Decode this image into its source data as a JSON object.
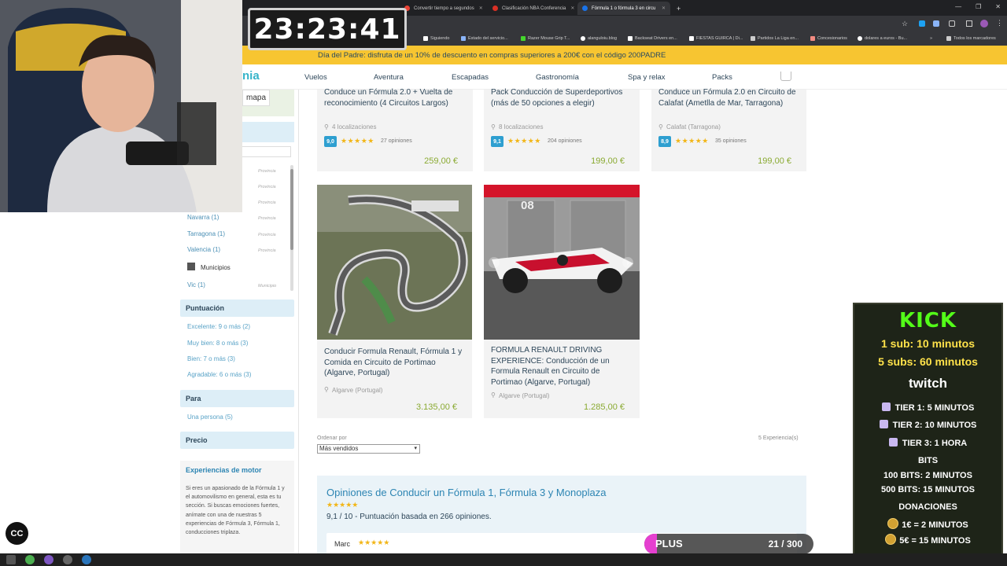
{
  "timer": "23:23:41",
  "browser": {
    "tabs": [
      {
        "label": "Convertir tiempo a segundos",
        "color": "#ea4335"
      },
      {
        "label": "Clasificación NBA Conferencia",
        "color": "#d93025"
      },
      {
        "label": "Fórmula 1 o fórmula 3 en circu",
        "color": "#1a73e8"
      }
    ],
    "new_tab": "+",
    "bookmarks": [
      "Siguiendo",
      "Estado del servicio...",
      "Razer Mouse Grip T...",
      "alanguloiu.blog",
      "Backseat Drivers en...",
      "FIESTAS GUIRCA | Di...",
      "Partidos La Liga en...",
      "Concesionarios",
      "dolares a euros - Bu...",
      "Todos los marcadores"
    ]
  },
  "promo": "Día del Padre: disfruta de un 10% de descuento en compras superiores a 200€ con el código 200PADRE",
  "site": {
    "logo": "nia",
    "nav": [
      "Vuelos",
      "Aventura",
      "Escapadas",
      "Gastronomía",
      "Spa y relax",
      "Packs"
    ]
  },
  "sidebar": {
    "map_label": "mapa",
    "provinces": [
      {
        "name": "Navarra (1)",
        "tag": "Provincia"
      },
      {
        "name": "Tarragona (1)",
        "tag": "Provincia"
      },
      {
        "name": "Valencia (1)",
        "tag": "Provincia"
      }
    ],
    "provincia_tags": [
      "Provincia",
      "Provincia",
      "Provincia"
    ],
    "municipios_label": "Municipios",
    "municipio": {
      "name": "Vic (1)",
      "tag": "Municipio"
    },
    "rating_head": "Puntuación",
    "ratings": [
      "Excelente: 9 o más (2)",
      "Muy bien: 8 o más (3)",
      "Bien: 7 o más (3)",
      "Agradable: 6 o más (3)"
    ],
    "para_head": "Para",
    "para_item": "Una persona (5)",
    "precio_head": "Precio",
    "motor_title": "Experiencias de motor",
    "motor_text": "Si eres un apasionado de la Fórmula 1 y el automovilismo en general, esta es tu sección. Si buscas emociones fuertes, anímate con una de nuestras 5 experiencias de Fórmula 3, Fórmula 1, conducciones triplaza."
  },
  "cards_top": [
    {
      "title": "Conduce un Fórmula 2.0 + Vuelta de reconocimiento (4 Circuitos Largos)",
      "loc": "4 localizaciones",
      "score": "9,0",
      "stars": "★★★★★",
      "opinions": "27 opiniones",
      "price": "259,00 €"
    },
    {
      "title": "Pack Conducción de Superdeportivos (más de 50 opciones a elegir)",
      "loc": "8 localizaciones",
      "score": "9,1",
      "stars": "★★★★★",
      "opinions": "204 opiniones",
      "price": "199,00 €"
    },
    {
      "title": "Conduce un Fórmula 2.0 en Circuito de Calafat (Ametlla de Mar, Tarragona)",
      "loc": "Calafat (Tarragona)",
      "score": "8,9",
      "stars": "★★★★★",
      "opinions": "35 opiniones",
      "price": "199,00 €"
    }
  ],
  "cards_bottom": [
    {
      "title": "Conducir Formula Renault, Fórmula 1 y Comida en Circuito de Portimao (Algarve, Portugal)",
      "loc": "Algarve (Portugal)",
      "price": "3.135,00 €"
    },
    {
      "title": "FORMULA RENAULT DRIVING EXPERIENCE: Conducción de un Formula Renault en Circuito de Portimao (Algarve, Portugal)",
      "loc": "Algarve (Portugal)",
      "price": "1.285,00 €"
    }
  ],
  "car_number": "08",
  "sort": {
    "label": "Ordenar por",
    "value": "Más vendidos"
  },
  "results_count": "5 Experiencia(s)",
  "reviews": {
    "title": "Opiniones de Conducir un Fórmula 1, Fórmula 3 y Monoplaza",
    "stars": "★★★★★",
    "score": "9,1 / 10 - Puntuación basada en 266 opiniones.",
    "first_name": "Marc",
    "first_stars": "★★★★★"
  },
  "panel": {
    "kick": "KICK",
    "kick_1": "1 sub: 10 minutos",
    "kick_5": "5 subs: 60 minutos",
    "twitch": "twitch",
    "tier1": "TIER 1: 5 MINUTOS",
    "tier2": "TIER 2: 10 MINUTOS",
    "tier3": "TIER 3: 1 HORA",
    "bits_head": "BITS",
    "bits_100": "100 BITS: 2 MINUTOS",
    "bits_500": "500 BITS: 15 MINUTOS",
    "don_head": "DONACIONES",
    "don_1": "1€ = 2 MINUTOS",
    "don_5": "5€ = 15 MINUTOS"
  },
  "goal": {
    "label": "PLUS",
    "count": "21 / 300",
    "progress": 0.07,
    "color": "#e11fc8"
  },
  "cc_label": "CC"
}
